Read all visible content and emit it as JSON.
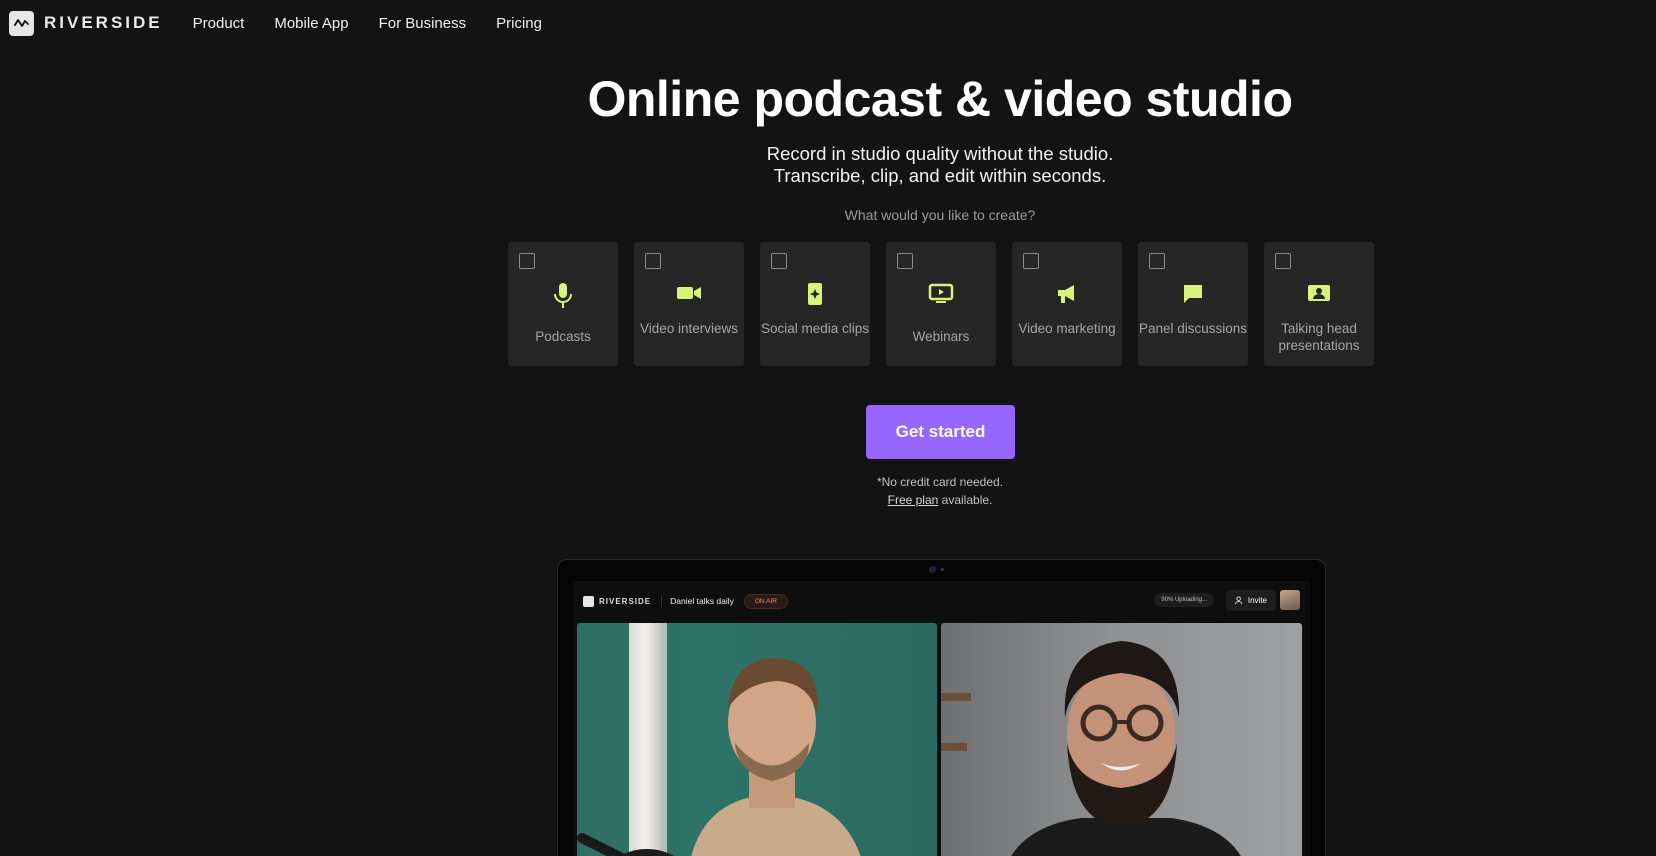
{
  "nav": {
    "brand": "RIVERSIDE",
    "links": [
      "Product",
      "Mobile App",
      "For Business",
      "Pricing"
    ]
  },
  "hero": {
    "title": "Online podcast & video studio",
    "subtitle_line1": "Record in studio quality without the studio.",
    "subtitle_line2": "Transcribe, clip, and edit within seconds.",
    "question": "What would you like to create?"
  },
  "options": [
    {
      "label": "Podcasts",
      "icon": "microphone-icon"
    },
    {
      "label": "Video interviews",
      "icon": "video-camera-icon"
    },
    {
      "label": "Social media clips",
      "icon": "sparkle-phone-icon"
    },
    {
      "label": "Webinars",
      "icon": "presentation-play-icon"
    },
    {
      "label": "Video marketing",
      "icon": "megaphone-icon"
    },
    {
      "label": "Panel discussions",
      "icon": "chat-bubble-icon"
    },
    {
      "label": "Talking head presentations",
      "icon": "person-card-icon"
    }
  ],
  "cta": {
    "label": "Get started",
    "note_line1": "*No credit card needed.",
    "free_plan_link": "Free plan",
    "note_line2_rest": " available."
  },
  "preview": {
    "brand": "RIVERSIDE",
    "session_title": "Daniel talks daily",
    "status": "ON AIR",
    "upload_status": "90% Uploading...",
    "invite_label": "Invite"
  },
  "colors": {
    "background": "#131313",
    "accent": "#9666ff",
    "icon": "#d9f27a",
    "card": "#262626"
  }
}
